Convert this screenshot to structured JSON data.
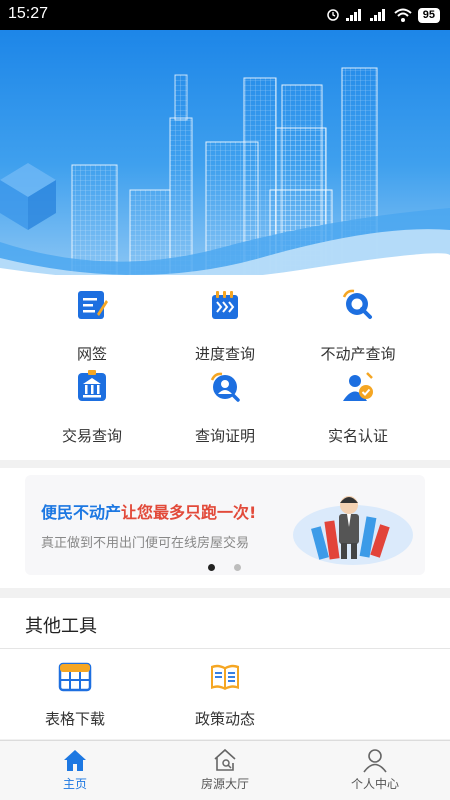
{
  "status_bar": {
    "time": "15:27",
    "battery": "95"
  },
  "menu": [
    {
      "label": "网签",
      "icon": "contract-icon"
    },
    {
      "label": "进度查询",
      "icon": "progress-icon"
    },
    {
      "label": "不动产查询",
      "icon": "property-search-icon"
    },
    {
      "label": "交易查询",
      "icon": "transaction-icon"
    },
    {
      "label": "查询证明",
      "icon": "certificate-search-icon"
    },
    {
      "label": "实名认证",
      "icon": "verify-user-icon"
    }
  ],
  "promo": {
    "title_blue": "便民不动产",
    "title_red": "让您最多只跑一次!",
    "subtitle": "真正做到不用出门便可在线房屋交易",
    "slides": 2,
    "active_slide": 1
  },
  "tools": {
    "title": "其他工具",
    "items": [
      {
        "label": "表格下载",
        "icon": "table-icon"
      },
      {
        "label": "政策动态",
        "icon": "book-icon"
      }
    ]
  },
  "nav": [
    {
      "label": "主页",
      "icon": "home-icon",
      "active": true
    },
    {
      "label": "房源大厅",
      "icon": "house-search-icon",
      "active": false
    },
    {
      "label": "个人中心",
      "icon": "user-icon",
      "active": false
    }
  ],
  "colors": {
    "accent": "#1d78e2",
    "promo_red": "#e24a3a",
    "icon_orange": "#f5a623"
  }
}
